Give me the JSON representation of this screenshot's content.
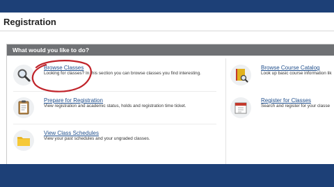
{
  "page": {
    "title": "Registration"
  },
  "panel": {
    "header": "What would you like to do?"
  },
  "items": [
    {
      "title": "Browse Classes",
      "desc": "Looking for classes? In this section you can browse classes you find interesting.",
      "icon": "magnifier-icon"
    },
    {
      "title": "Prepare for Registration",
      "desc": "View registration and academic status, holds and registration time ticket.",
      "icon": "clipboard-icon"
    },
    {
      "title": "View Class Schedules",
      "desc": "View your past schedules and your ungraded classes.",
      "icon": "folder-icon"
    },
    {
      "title": "Browse Course Catalog",
      "desc": "Look up basic course information lik",
      "icon": "book-icon"
    },
    {
      "title": "Register for Classes",
      "desc": "Search and register for your classe",
      "icon": "calendar-icon"
    }
  ],
  "colors": {
    "brand_blue": "#1d4077",
    "header_gray": "#6f7174",
    "link_blue": "#1f4e8c",
    "annotation_red": "#c0232a"
  }
}
